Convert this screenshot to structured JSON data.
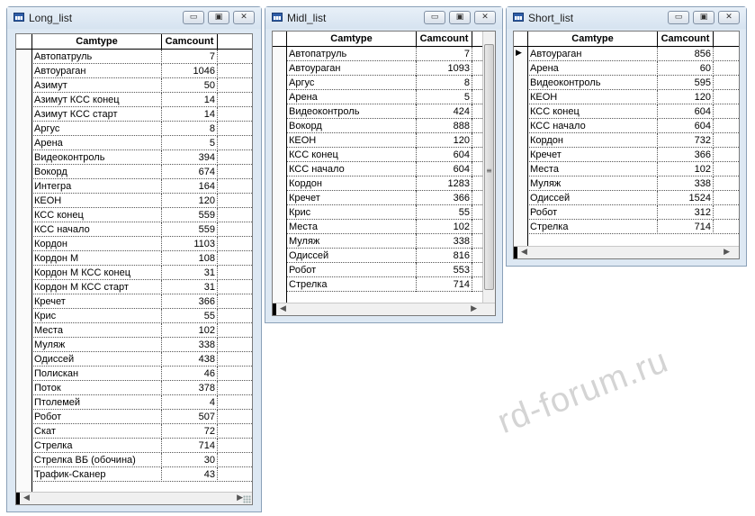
{
  "windows": [
    {
      "title": "Long_list",
      "columns": [
        "Camtype",
        "Camcount"
      ],
      "rows": [
        [
          "Автопатруль",
          "7"
        ],
        [
          "Автоураган",
          "1046"
        ],
        [
          "Азимут",
          "50"
        ],
        [
          "Азимут КСС конец",
          "14"
        ],
        [
          "Азимут КСС старт",
          "14"
        ],
        [
          "Аргус",
          "8"
        ],
        [
          "Арена",
          "5"
        ],
        [
          "Видеоконтроль",
          "394"
        ],
        [
          "Вокорд",
          "674"
        ],
        [
          "Интегра",
          "164"
        ],
        [
          "КЕОН",
          "120"
        ],
        [
          "КСС конец",
          "559"
        ],
        [
          "КСС начало",
          "559"
        ],
        [
          "Кордон",
          "1103"
        ],
        [
          "Кордон М",
          "108"
        ],
        [
          "Кордон М КСС конец",
          "31"
        ],
        [
          "Кордон М КСС старт",
          "31"
        ],
        [
          "Кречет",
          "366"
        ],
        [
          "Крис",
          "55"
        ],
        [
          "Места",
          "102"
        ],
        [
          "Муляж",
          "338"
        ],
        [
          "Одиссей",
          "438"
        ],
        [
          "Полискан",
          "46"
        ],
        [
          "Поток",
          "378"
        ],
        [
          "Птолемей",
          "4"
        ],
        [
          "Робот",
          "507"
        ],
        [
          "Скат",
          "72"
        ],
        [
          "Стрелка",
          "714"
        ],
        [
          "Стрелка ВБ (обочина)",
          "30"
        ],
        [
          "Трафик-Сканер",
          "43"
        ]
      ]
    },
    {
      "title": "Midl_list",
      "columns": [
        "Camtype",
        "Camcount"
      ],
      "rows": [
        [
          "Автопатруль",
          "7"
        ],
        [
          "Автоураган",
          "1093"
        ],
        [
          "Аргус",
          "8"
        ],
        [
          "Арена",
          "5"
        ],
        [
          "Видеоконтроль",
          "424"
        ],
        [
          "Вокорд",
          "888"
        ],
        [
          "КЕОН",
          "120"
        ],
        [
          "КСС конец",
          "604"
        ],
        [
          "КСС начало",
          "604"
        ],
        [
          "Кордон",
          "1283"
        ],
        [
          "Кречет",
          "366"
        ],
        [
          "Крис",
          "55"
        ],
        [
          "Места",
          "102"
        ],
        [
          "Муляж",
          "338"
        ],
        [
          "Одиссей",
          "816"
        ],
        [
          "Робот",
          "553"
        ],
        [
          "Стрелка",
          "714"
        ]
      ]
    },
    {
      "title": "Short_list",
      "columns": [
        "Camtype",
        "Camcount"
      ],
      "rows": [
        [
          "Автоураган",
          "856"
        ],
        [
          "Арена",
          "60"
        ],
        [
          "Видеоконтроль",
          "595"
        ],
        [
          "КЕОН",
          "120"
        ],
        [
          "КСС конец",
          "604"
        ],
        [
          "КСС начало",
          "604"
        ],
        [
          "Кордон",
          "732"
        ],
        [
          "Кречет",
          "366"
        ],
        [
          "Места",
          "102"
        ],
        [
          "Муляж",
          "338"
        ],
        [
          "Одиссей",
          "1524"
        ],
        [
          "Робот",
          "312"
        ],
        [
          "Стрелка",
          "714"
        ]
      ]
    }
  ],
  "controls": {
    "minimize": "▭",
    "maximize": "▣",
    "close": "✕",
    "scroll_left": "◀",
    "scroll_right": "▶",
    "scroll_up": "▲",
    "scroll_down": "▼",
    "thumb_grip": "≡"
  },
  "icons": {
    "window_icon": "table-icon",
    "row_pointer": "row-pointer-icon"
  },
  "watermark": "rd-forum.ru",
  "colors": {
    "frame": "#dde8f3",
    "grid_bg": "#ffffff"
  }
}
